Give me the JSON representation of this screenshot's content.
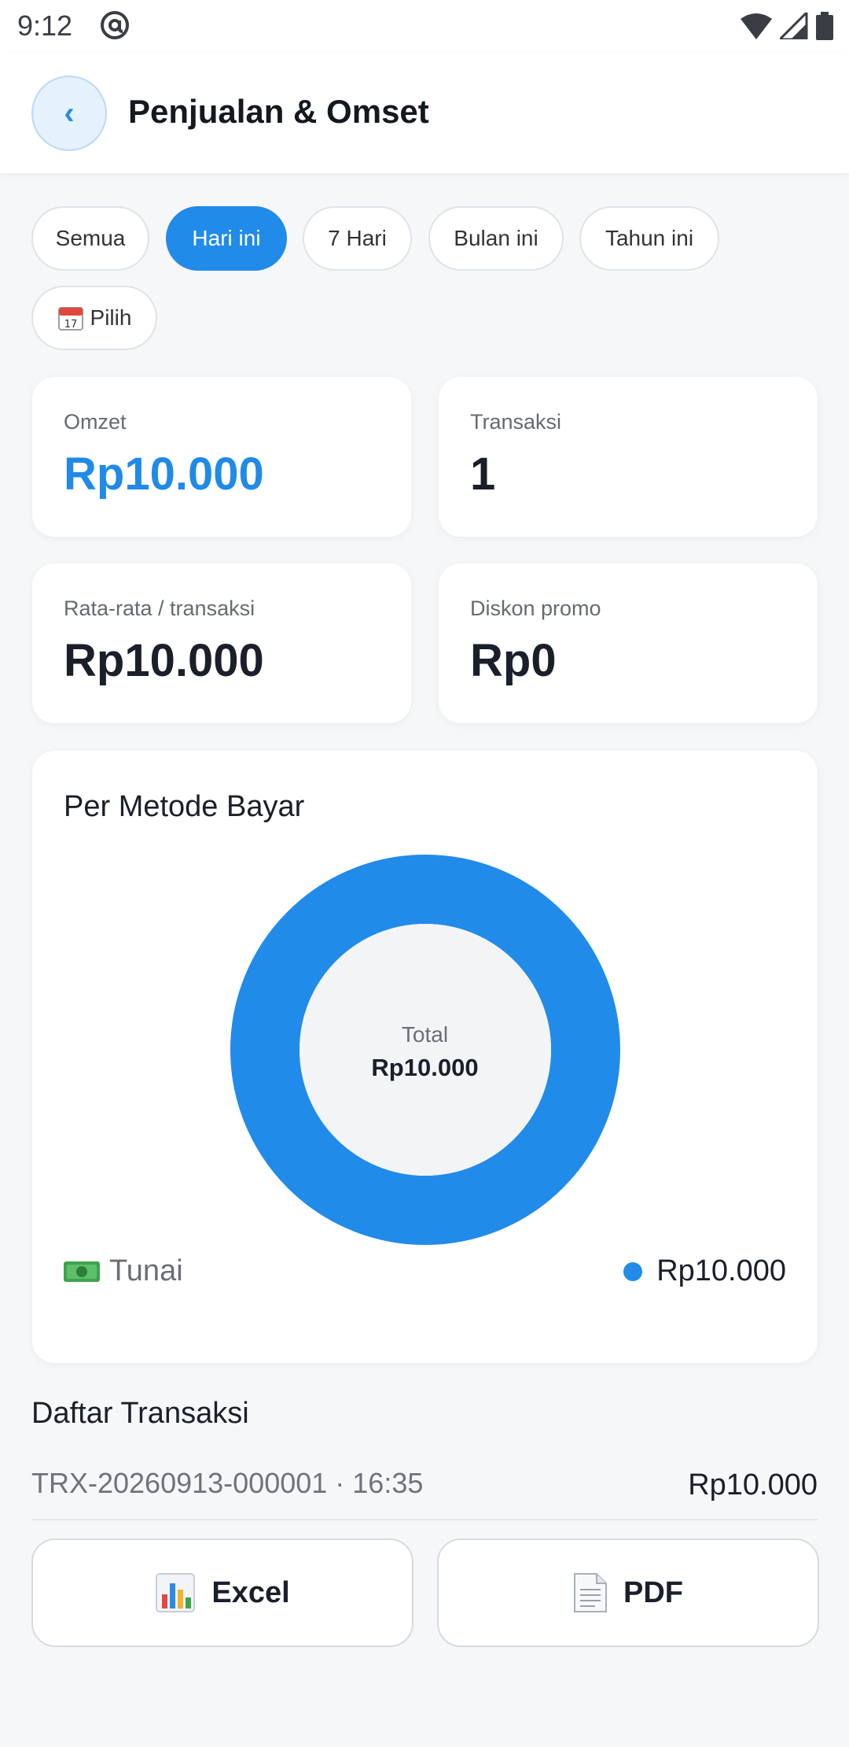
{
  "status_bar": {
    "time": "9:12"
  },
  "header": {
    "back_icon": "chevron-left-icon",
    "title": "Penjualan & Omset"
  },
  "filters": [
    {
      "label": "Semua",
      "active": false
    },
    {
      "label": "Hari ini",
      "active": true
    },
    {
      "label": "7 Hari",
      "active": false
    },
    {
      "label": "Bulan ini",
      "active": false
    },
    {
      "label": "Tahun ini",
      "active": false
    },
    {
      "label": "Pilih",
      "active": false,
      "icon": "calendar-icon"
    }
  ],
  "stats": {
    "omzet": {
      "label": "Omzet",
      "value": "Rp10.000"
    },
    "transaksi": {
      "label": "Transaksi",
      "value": "1"
    },
    "rata_rata": {
      "label": "Rata-rata / transaksi",
      "value": "Rp10.000"
    },
    "diskon": {
      "label": "Diskon promo",
      "value": "Rp0"
    }
  },
  "payment_method": {
    "title": "Per Metode Bayar",
    "center_label": "Total",
    "center_value": "Rp10.000",
    "legend": [
      {
        "icon": "cash-icon",
        "name": "Tunai",
        "amount": "Rp10.000",
        "color": "#218be9"
      }
    ]
  },
  "chart_data": {
    "type": "pie",
    "title": "Per Metode Bayar",
    "categories": [
      "Tunai"
    ],
    "values": [
      10000
    ],
    "colors": [
      "#218be9"
    ]
  },
  "transactions": {
    "title": "Daftar Transaksi",
    "items": [
      {
        "id_time": "TRX-20260913-000001 · 16:35",
        "amount": "Rp10.000"
      }
    ]
  },
  "export": {
    "excel_label": "Excel",
    "excel_icon": "bar-chart-icon",
    "pdf_label": "PDF",
    "pdf_icon": "document-icon"
  },
  "colors": {
    "accent": "#218be9",
    "background": "#f6f7f9"
  }
}
